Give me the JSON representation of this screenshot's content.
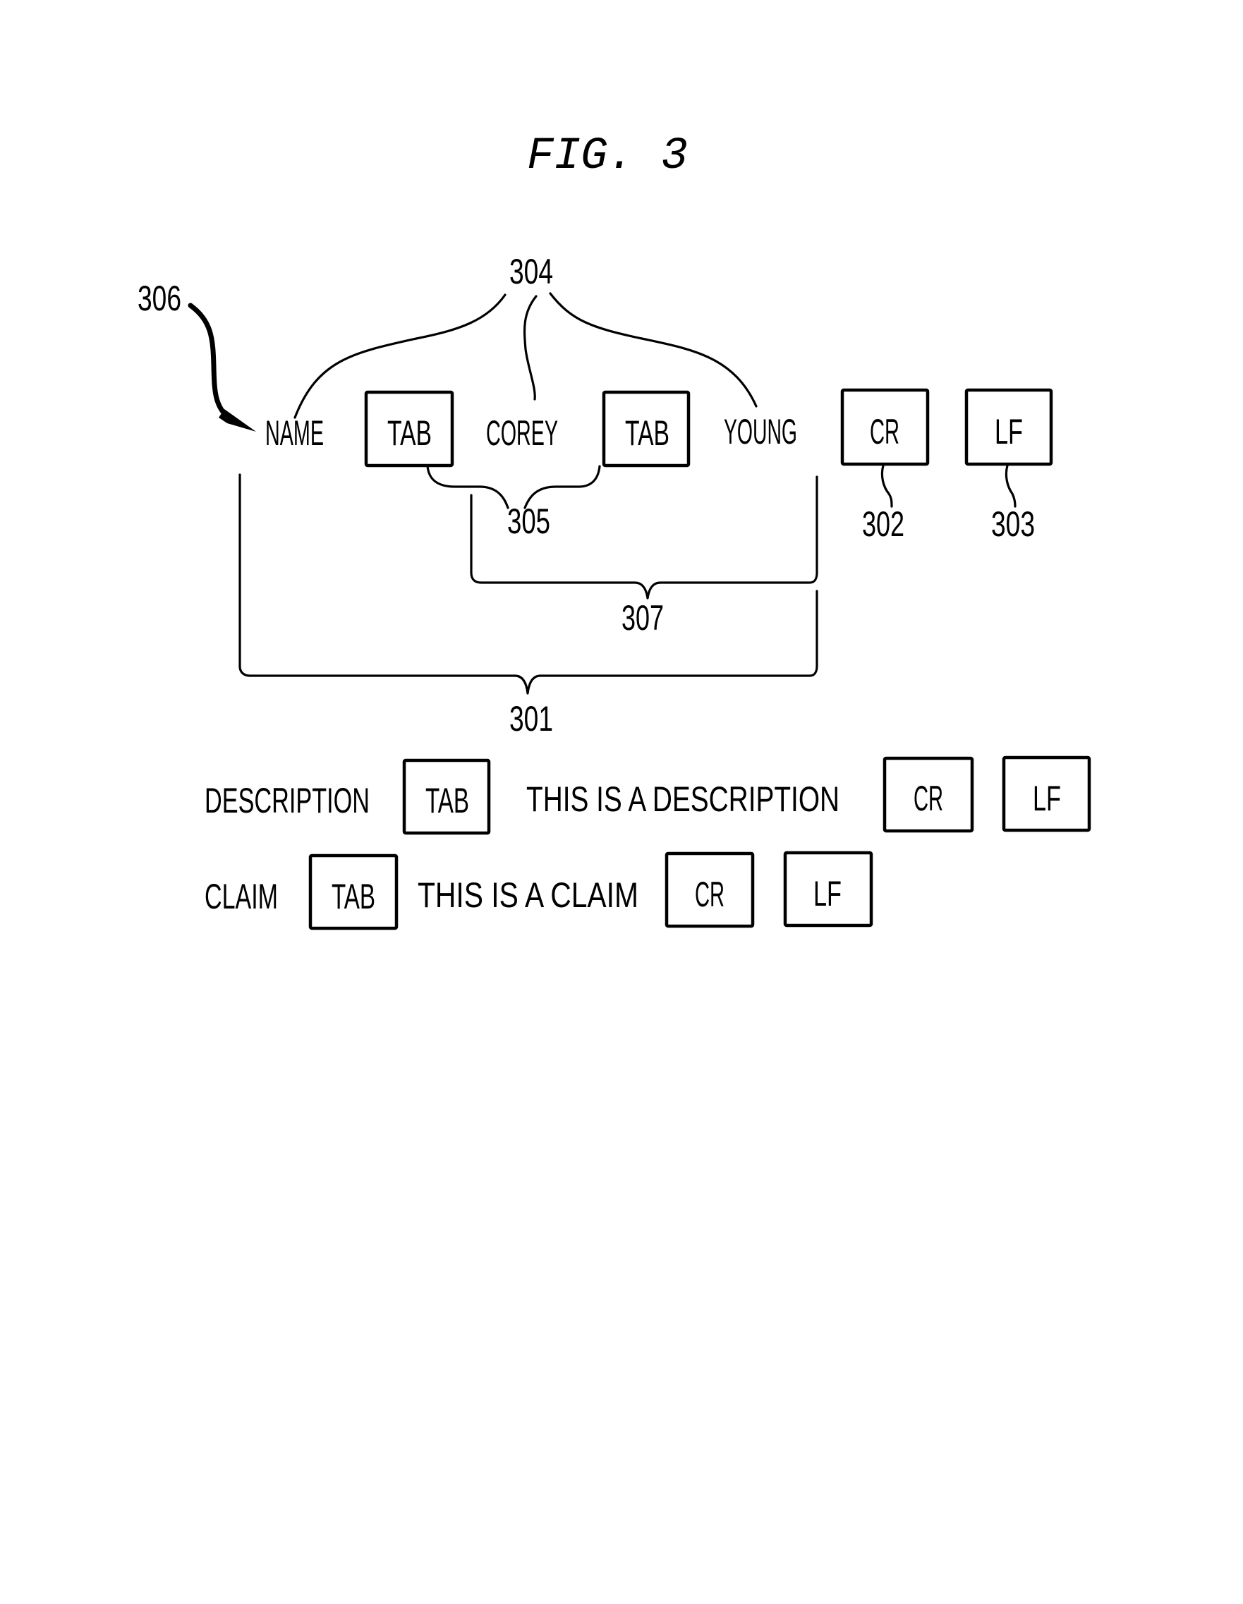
{
  "figure": {
    "title": "FIG. 3"
  },
  "record_name": {
    "field_label": "NAME",
    "separator_1": "TAB",
    "value_part_1": "COREY",
    "separator_2": "TAB",
    "value_part_2": "YOUNG",
    "carriage_return": "CR",
    "line_feed": "LF"
  },
  "record_description": {
    "field_label": "DESCRIPTION",
    "separator": "TAB",
    "value": "THIS IS A DESCRIPTION",
    "carriage_return": "CR",
    "line_feed": "LF"
  },
  "record_claim": {
    "field_label": "CLAIM",
    "separator": "TAB",
    "value": "THIS IS A CLAIM",
    "carriage_return": "CR",
    "line_feed": "LF"
  },
  "reference_numerals": {
    "record": "301",
    "carriage_return": "302",
    "line_feed": "303",
    "data_items": "304",
    "tab_separators": "305",
    "field_name": "306",
    "field_value": "307"
  }
}
